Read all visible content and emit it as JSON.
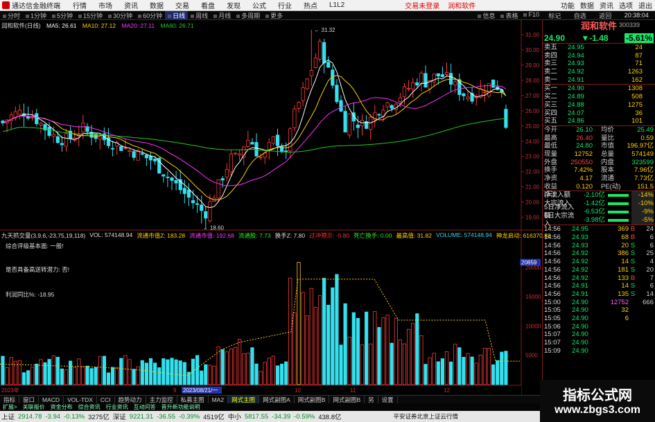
{
  "menubar": {
    "app_title": "通达信金融终端",
    "menus": [
      "行情",
      "市场",
      "资讯",
      "数据",
      "交易",
      "看盘",
      "发现",
      "公式",
      "行业",
      "热点",
      "L1L2"
    ],
    "notice": "交易未登录",
    "notice2": "润和软件",
    "right": [
      "功能",
      "数据",
      "资讯",
      "选项",
      "退出"
    ]
  },
  "toolbar": {
    "periods": [
      "分时",
      "1分钟",
      "5分钟",
      "15分钟",
      "30分钟",
      "60分钟",
      "日线",
      "周线",
      "月线",
      "多周期",
      "更多"
    ],
    "selected": "日线",
    "right": [
      "信息",
      "表格",
      "F10",
      "标记",
      "自选",
      "返回"
    ]
  },
  "kinfo": {
    "name": "润和软件(日线)",
    "ma5": "MA5: 26.61",
    "ma10": "MA10: 27.12",
    "ma20": "MA20: 27.11",
    "ma60": "MA60: 26.71"
  },
  "price_axis": [
    "31.00",
    "30.00",
    "29.00",
    "28.00",
    "27.00",
    "26.00",
    "25.00",
    "24.00",
    "23.00",
    "22.00",
    "21.00",
    "20.00",
    "19.00"
  ],
  "high_label": "31.32",
  "low_label": "18.60",
  "ind_info": {
    "name": "九天抓交量(3,9,6,-23,75,19,118)",
    "vol": "VOL: 574148.94",
    "ltsz": "流通市值Z: 183.28",
    "ltsz2": "流通市值: 192.68",
    "lthsl": "流通股: 7.73",
    "hsl": "换手Z: 7.80",
    "gr": "过冲预示: -5.80",
    "sw": "死亡换手: 0.00",
    "ltjb": "最高值: 31.82",
    "volume": "VOLUME: 574148.94",
    "qd": "神龙启动: 616370.88"
  },
  "ind_annot": {
    "a1": "综合评级基本面: 一般!",
    "a2": "是否具备高送转潜力: 否!",
    "a3": "利润同比%: -18.95"
  },
  "vol_axis": [
    "20000",
    "15000",
    "10000",
    "5000"
  ],
  "vol_marker": "20859",
  "date_label": "2023/08/21/一",
  "month_labels": [
    "2023年",
    "",
    "9",
    "10",
    "11",
    "12"
  ],
  "right": {
    "stock_name": "润和软件",
    "code": "300339",
    "price": "24.90",
    "change": "▼-1.48",
    "pct": "-5.61%",
    "asks": [
      {
        "k": "卖五",
        "p": "24.95",
        "v": "24"
      },
      {
        "k": "卖四",
        "p": "24.94",
        "v": "87"
      },
      {
        "k": "卖三",
        "p": "24.93",
        "v": "71"
      },
      {
        "k": "卖二",
        "p": "24.92",
        "v": "1263"
      },
      {
        "k": "卖一",
        "p": "24.91",
        "v": "162"
      }
    ],
    "bids": [
      {
        "k": "买一",
        "p": "24.90",
        "v": "1308"
      },
      {
        "k": "买二",
        "p": "24.89",
        "v": "508"
      },
      {
        "k": "买三",
        "p": "24.88",
        "v": "1275"
      },
      {
        "k": "买四",
        "p": "24.07",
        "v": "36"
      },
      {
        "k": "买五",
        "p": "24.86",
        "v": "101"
      }
    ],
    "quotes": [
      {
        "a": "今开",
        "b": "26.10",
        "bc": "g",
        "d": "均价",
        "e": "25.49",
        "ec": "g"
      },
      {
        "a": "最高",
        "b": "26.40",
        "bc": "r",
        "d": "量比",
        "e": "0.59",
        "ec": "y"
      },
      {
        "a": "最低",
        "b": "24.80",
        "bc": "g",
        "d": "市值",
        "e": "196.97亿",
        "ec": "y"
      },
      {
        "a": "现量",
        "b": "12752",
        "bc": "y",
        "d": "总量",
        "e": "574149",
        "ec": "y"
      },
      {
        "a": "外盘",
        "b": "250550",
        "bc": "r",
        "d": "内盘",
        "e": "323599",
        "ec": "g"
      },
      {
        "a": "换手",
        "b": "7.42%",
        "bc": "y",
        "d": "股本",
        "e": "7.96亿",
        "ec": "y"
      },
      {
        "a": "净资",
        "b": "4.17",
        "bc": "y",
        "d": "流通",
        "e": "7.73亿",
        "ec": "y"
      },
      {
        "a": "收益(三)",
        "b": "0.120",
        "bc": "y",
        "d": "PE(动)",
        "e": "151.5",
        "ec": "y"
      }
    ],
    "flows": [
      {
        "k": "净流入额",
        "v": "-2.10亿",
        "pc": "-14%",
        "bar": "#19e66a"
      },
      {
        "k": "大宗流入",
        "v": "-1.42亿",
        "pc": "-10%",
        "bar": "#19e66a"
      },
      {
        "k": "5日净流入额",
        "v": "-6.53亿",
        "pc": "-9%",
        "bar": "#19e66a"
      },
      {
        "k": "5日大宗流入",
        "v": "-3.98亿",
        "pc": "-5%",
        "bar": "#19e66a"
      }
    ],
    "ticks": [
      {
        "t": "14:56",
        "p": "24.95",
        "pc": "g",
        "v": "369",
        "vc": "y",
        "s": "B",
        "sc": "r",
        "n": "24"
      },
      {
        "t": "14:56",
        "p": "24.93",
        "pc": "g",
        "v": "68",
        "vc": "y",
        "s": "B",
        "sc": "r",
        "n": "6"
      },
      {
        "t": "14:56",
        "p": "24.93",
        "pc": "g",
        "v": "20",
        "vc": "y",
        "s": "S",
        "sc": "g",
        "n": "6"
      },
      {
        "t": "14:56",
        "p": "24.92",
        "pc": "g",
        "v": "386",
        "vc": "y",
        "s": "S",
        "sc": "g",
        "n": "25"
      },
      {
        "t": "14:56",
        "p": "24.92",
        "pc": "g",
        "v": "14",
        "vc": "y",
        "s": "S",
        "sc": "g",
        "n": "4"
      },
      {
        "t": "14:56",
        "p": "24.92",
        "pc": "g",
        "v": "181",
        "vc": "y",
        "s": "S",
        "sc": "g",
        "n": "20"
      },
      {
        "t": "14:56",
        "p": "24.92",
        "pc": "g",
        "v": "133",
        "vc": "y",
        "s": "B",
        "sc": "r",
        "n": "7"
      },
      {
        "t": "14:56",
        "p": "24.91",
        "pc": "g",
        "v": "14",
        "vc": "y",
        "s": "S",
        "sc": "g",
        "n": "6"
      },
      {
        "t": "14:56",
        "p": "24.91",
        "pc": "g",
        "v": "135",
        "vc": "y",
        "s": "S",
        "sc": "g",
        "n": "14"
      },
      {
        "t": "15:00",
        "p": "24.90",
        "pc": "g",
        "v": "12752",
        "vc": "m2",
        "s": "",
        "sc": "w",
        "n": "666"
      },
      {
        "t": "15:05",
        "p": "24.90",
        "pc": "g",
        "v": "32",
        "vc": "y",
        "s": "",
        "sc": "w",
        "n": ""
      },
      {
        "t": "15:05",
        "p": "24.90",
        "pc": "g",
        "v": "6",
        "vc": "y",
        "s": "",
        "sc": "w",
        "n": ""
      },
      {
        "t": "15:06",
        "p": "24.90",
        "pc": "g",
        "v": "",
        "vc": "y",
        "s": "",
        "sc": "w",
        "n": ""
      },
      {
        "t": "15:07",
        "p": "24.90",
        "pc": "g",
        "v": "",
        "vc": "y",
        "s": "",
        "sc": "w",
        "n": ""
      },
      {
        "t": "15:07",
        "p": "24.90",
        "pc": "g",
        "v": "",
        "vc": "y",
        "s": "",
        "sc": "w",
        "n": ""
      },
      {
        "t": "15:09",
        "p": "24.90",
        "pc": "g",
        "v": "",
        "vc": "y",
        "s": "",
        "sc": "w",
        "n": ""
      }
    ]
  },
  "bottomtabs": [
    "指标",
    "窗口",
    "MACD",
    "VOL-TDX",
    "CCI",
    "趋势动力",
    "主力监控",
    "私募主图",
    "MA2",
    "网式主图",
    "网式副图A",
    "网式副图B",
    "网式副图B",
    "另",
    "设置"
  ],
  "bottom_selected": "网式主图",
  "subtabs": [
    "扩展>",
    "关联报价",
    "资金分布",
    "综合资讯",
    "行业资讯",
    "互动问答",
    "晋升新功能说明"
  ],
  "status": {
    "sh_name": "上证",
    "sh": "2914.78",
    "sh_ch": "-3.94",
    "sh_pct": "-0.13%",
    "sh_amt": "3275亿",
    "sz_name": "深证",
    "sz": "9221.31",
    "sz_ch": "-36.55",
    "sz_pct": "-0.39%",
    "sz_amt": "4519亿",
    "zx_name": "中小",
    "zx": "5817.55",
    "zx_ch": "-34.39",
    "zx_pct": "-0.59%",
    "zx_amt": "438.8亿",
    "broker": "平安证券北京上证云行情"
  },
  "watermark": {
    "line1": "指标公式网",
    "line2": "www.zbgs3.com"
  },
  "time": "20:38:04"
}
